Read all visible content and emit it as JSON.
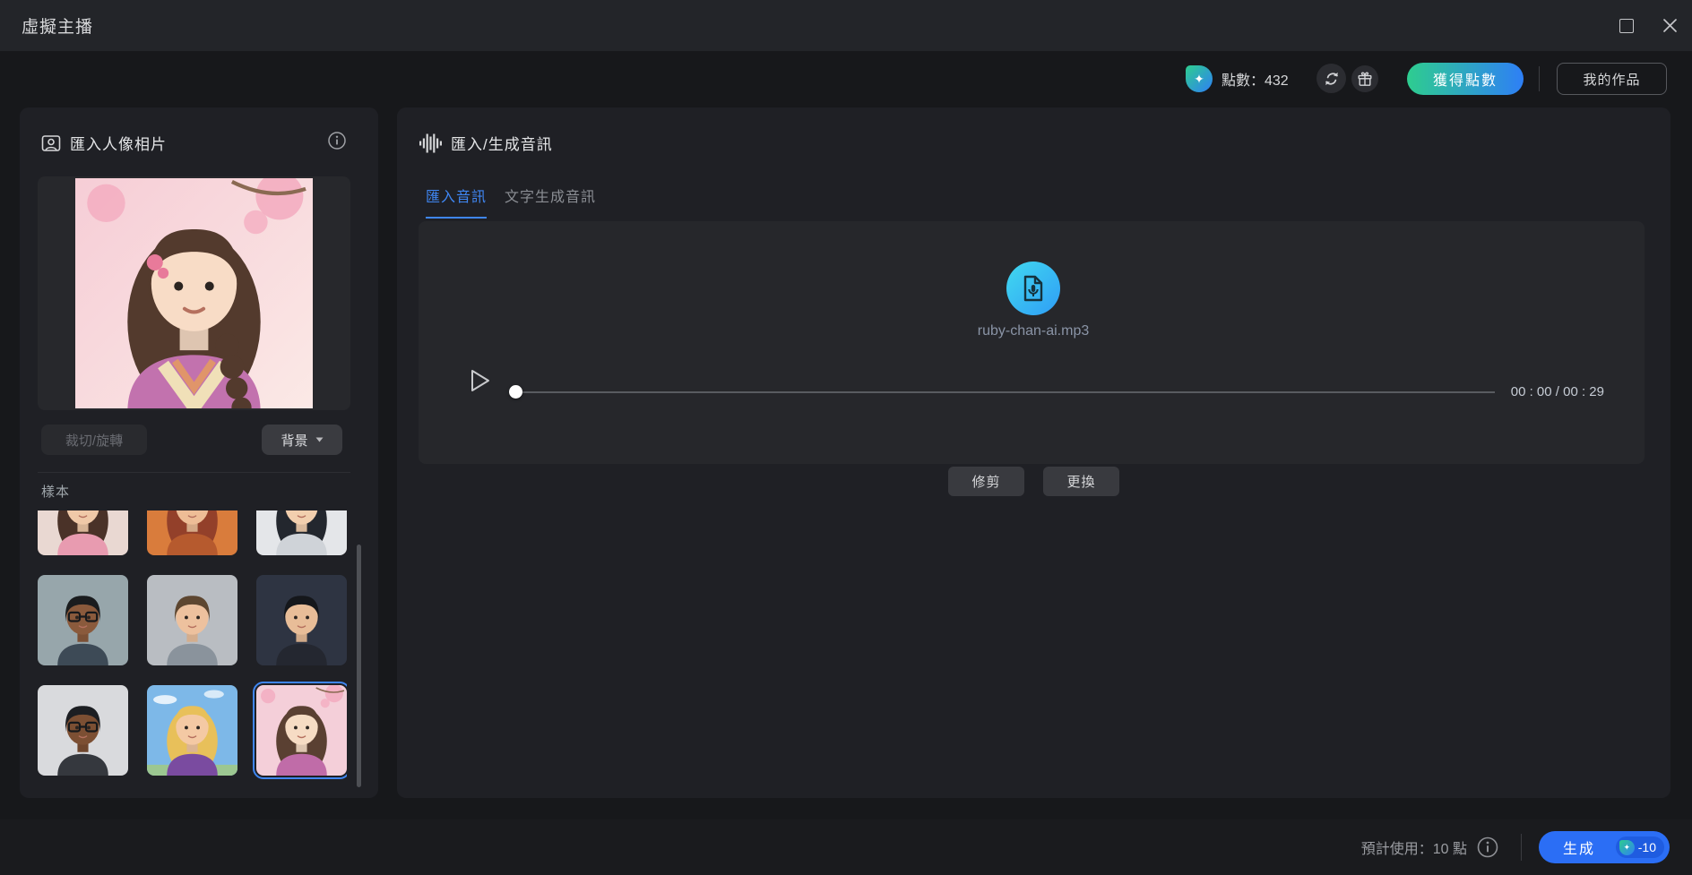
{
  "window": {
    "title": "虛擬主播"
  },
  "header": {
    "points_label": "點數：432",
    "get_points_label": "獲得點數",
    "my_works_label": "我的作品"
  },
  "left_panel": {
    "title": "匯入人像相片",
    "crop_rotate_label": "裁切/旋轉",
    "background_label": "背景",
    "samples_label": "樣本",
    "portrait": {
      "name": "anime-woman-kimono",
      "bg": "#f6cdd6",
      "bg2": "#fbe9e6",
      "hair": "#533a2d",
      "skin": "#f8dcc6",
      "shirt": "#c272ae",
      "collar": "#f0e0b8",
      "blossom": "#f3a8bd",
      "deco": "sakura",
      "long": true,
      "detail": "kimono"
    },
    "samples": [
      {
        "name": "woman-pink-blazer",
        "bg": "#e9d8d2",
        "hair": "#4a3228",
        "skin": "#f0c9a8",
        "shirt": "#e89bb0",
        "long": true
      },
      {
        "name": "woman-red-hair",
        "bg": "#d97c3c",
        "hair": "#93402a",
        "skin": "#eebd96",
        "shirt": "#b65a2e",
        "long": true
      },
      {
        "name": "woman-black-hair",
        "bg": "#e4e6e9",
        "hair": "#23272e",
        "skin": "#f2cfae",
        "shirt": "#cfd3d8",
        "long": true
      },
      {
        "name": "man-glasses-gray",
        "bg": "#97a6ab",
        "hair": "#1a1c1e",
        "skin": "#8a5a3c",
        "shirt": "#3d4a56",
        "glasses": true
      },
      {
        "name": "man-short-hair",
        "bg": "#b9bdc2",
        "hair": "#5d4630",
        "skin": "#edc19e",
        "shirt": "#8a939c"
      },
      {
        "name": "man-suit-dark",
        "bg": "#2e3442",
        "hair": "#15171b",
        "skin": "#e8bd98",
        "shirt": "#242730"
      },
      {
        "name": "man-glasses-light",
        "bg": "#d9dadd",
        "hair": "#1c1e22",
        "skin": "#7c4f33",
        "shirt": "#35383e",
        "glasses": true
      },
      {
        "name": "woman-blonde-cartoon",
        "bg": "#7db8e8",
        "hair": "#e8c05a",
        "skin": "#f4c9a4",
        "shirt": "#7a4ba0",
        "long": true,
        "deco": "sky"
      },
      {
        "name": "woman-anime-kimono",
        "bg": "#f4cfd9",
        "hair": "#5a4032",
        "skin": "#f6dcc4",
        "shirt": "#c06ca8",
        "long": true,
        "deco": "sakura",
        "selected": true
      }
    ]
  },
  "audio_panel": {
    "title": "匯入/生成音訊",
    "tabs": [
      {
        "label": "匯入音訊",
        "active": true
      },
      {
        "label": "文字生成音訊",
        "active": false
      }
    ],
    "file_name": "ruby-chan-ai.mp3",
    "time_display": "00 : 00 / 00 : 29",
    "trim_label": "修剪",
    "replace_label": "更換"
  },
  "footer": {
    "estimate_label": "預計使用：10 點",
    "generate_label": "生成",
    "cost_label": "-10"
  },
  "colors": {
    "accent_blue": "#3f86f2",
    "gradient_green": "#2ecd8f",
    "gradient_blue": "#2e7ff6",
    "cyan1": "#41d9ef",
    "cyan2": "#2f9df6",
    "generate_blue": "#2b6ef5"
  },
  "icons": {
    "points_badge": "sparkle-drop",
    "refresh": "refresh-arrows",
    "gift": "gift-box",
    "portrait_header": "portrait-frame",
    "info": "info-circle",
    "audio_header": "waveform",
    "audio_file": "document-microphone",
    "play": "play-triangle",
    "background_caret": "chevron-down"
  }
}
